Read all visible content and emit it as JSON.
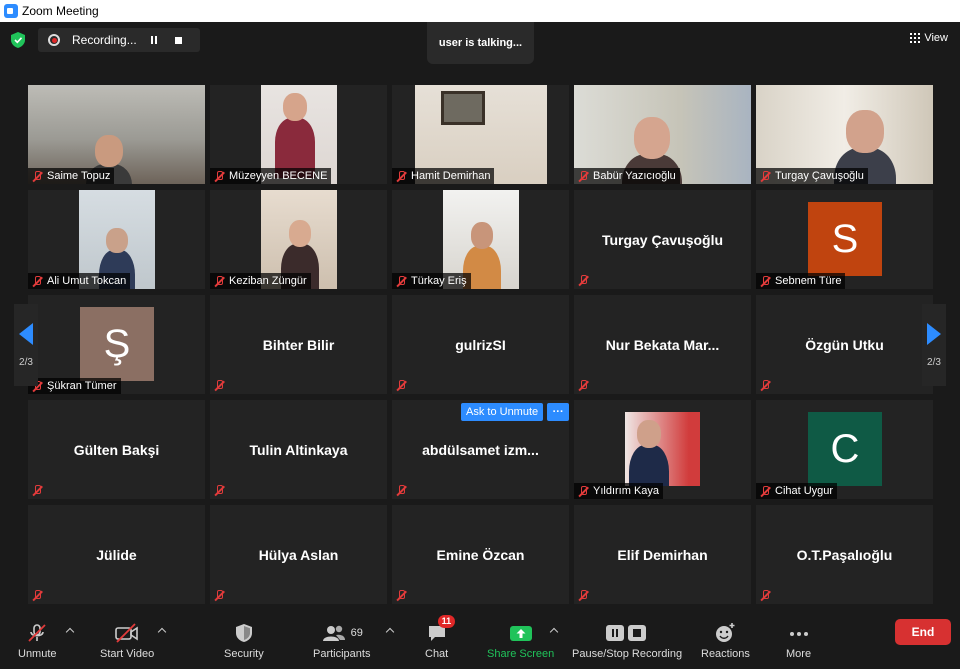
{
  "window": {
    "title": "Zoom Meeting"
  },
  "top": {
    "recording_label": "Recording...",
    "talking_label": "user is talking...",
    "view_label": "View"
  },
  "pager": {
    "left_page": "2/3",
    "right_page": "2/3"
  },
  "ask_unmute": {
    "label": "Ask to Unmute",
    "more": "···"
  },
  "participants": [
    {
      "name": "Saime Topuz",
      "type": "video"
    },
    {
      "name": "Müzeyyen BECENE",
      "type": "video"
    },
    {
      "name": "Hamit Demirhan",
      "type": "video"
    },
    {
      "name": "Babür  Yazıcıoğlu",
      "type": "video"
    },
    {
      "name": "Turgay Çavuşoğlu",
      "type": "video"
    },
    {
      "name": "Ali Umut Tokcan",
      "type": "video"
    },
    {
      "name": "Keziban Züngür",
      "type": "video"
    },
    {
      "name": "Türkay Eriş",
      "type": "video"
    },
    {
      "name": "Turgay Çavuşoğlu",
      "type": "text"
    },
    {
      "name": "Sebnem Türe",
      "type": "avatar",
      "initial": "S",
      "color": "#c0440f"
    },
    {
      "name": "Şükran Tümer",
      "type": "avatar",
      "initial": "Ş",
      "color": "#8b6f63"
    },
    {
      "name": "Bihter Bilir",
      "type": "text"
    },
    {
      "name": "gulrizSI",
      "type": "text"
    },
    {
      "name": "Nur  Bekata  Mar...",
      "type": "text"
    },
    {
      "name": "Özgün Utku",
      "type": "text"
    },
    {
      "name": "Gülten Bakşi",
      "type": "text"
    },
    {
      "name": "Tulin Altinkaya",
      "type": "text"
    },
    {
      "name": "abdülsamet  izm...",
      "type": "text"
    },
    {
      "name": "Yıldırım Kaya",
      "type": "video"
    },
    {
      "name": "Cihat Uygur",
      "type": "avatar",
      "initial": "C",
      "color": "#0f5a45"
    },
    {
      "name": "Jülide",
      "type": "text"
    },
    {
      "name": "Hülya Aslan",
      "type": "text"
    },
    {
      "name": "Emine Özcan",
      "type": "text"
    },
    {
      "name": "Elif Demirhan",
      "type": "text"
    },
    {
      "name": "O.T.Paşalıoğlu",
      "type": "text"
    }
  ],
  "toolbar": {
    "unmute": "Unmute",
    "start_video": "Start Video",
    "security": "Security",
    "participants": "Participants",
    "participants_count": "69",
    "chat": "Chat",
    "chat_badge": "11",
    "share_screen": "Share Screen",
    "pause_recording": "Pause/Stop Recording",
    "reactions": "Reactions",
    "more": "More",
    "end": "End"
  },
  "colors": {
    "accent": "#2d8cff",
    "end": "#d73131",
    "share": "#20c35a",
    "muted": "#e23b3b"
  }
}
